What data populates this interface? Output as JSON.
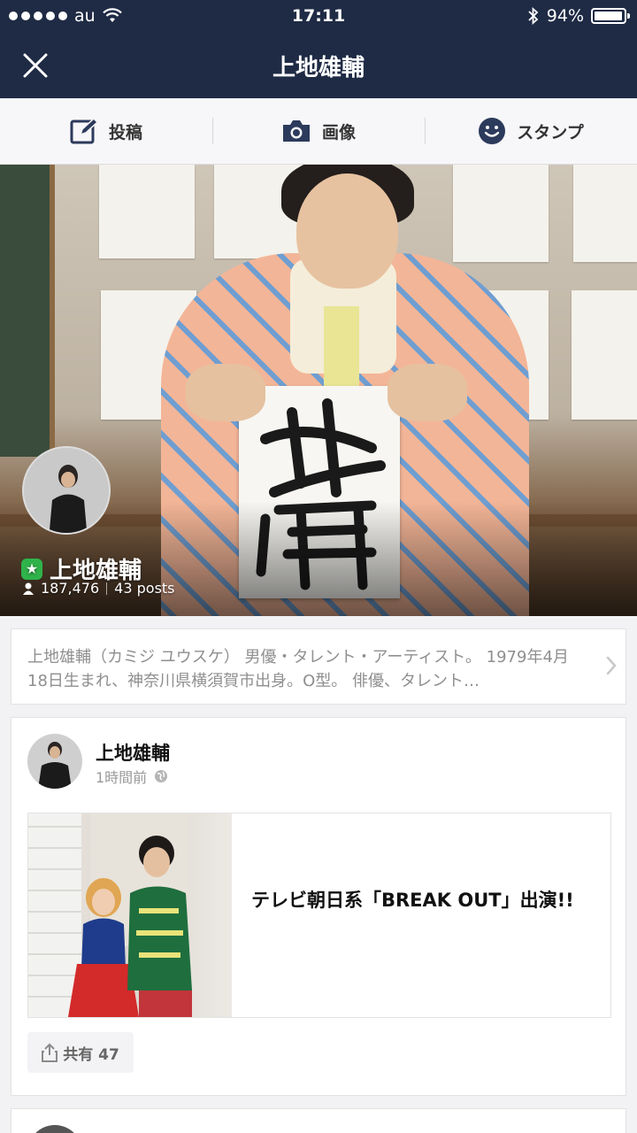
{
  "status_bar": {
    "carrier": "au",
    "time": "17:11",
    "battery": "94%"
  },
  "nav": {
    "title": "上地雄輔"
  },
  "compose": {
    "items": [
      {
        "label": "投稿",
        "icon": "edit-icon"
      },
      {
        "label": "画像",
        "icon": "camera-icon"
      },
      {
        "label": "スタンプ",
        "icon": "smiley-icon"
      }
    ]
  },
  "profile": {
    "name": "上地雄輔",
    "followers": "187,476",
    "posts": "43 posts",
    "description": "上地雄輔（カミジ ユウスケ） 男優・タレント・アーティスト。 1979年4月18日生まれ、神奈川県横須賀市出身。O型。 俳優、タレント…"
  },
  "post": {
    "author": "上地雄輔",
    "time": "1時間前",
    "link_title": "テレビ朝日系「BREAK OUT」出演!!",
    "share_label": "共有 47"
  },
  "colors": {
    "nav_bg": "#1f2b45",
    "accent_green": "#2fb34a",
    "icon_navy": "#2c3a5c"
  }
}
